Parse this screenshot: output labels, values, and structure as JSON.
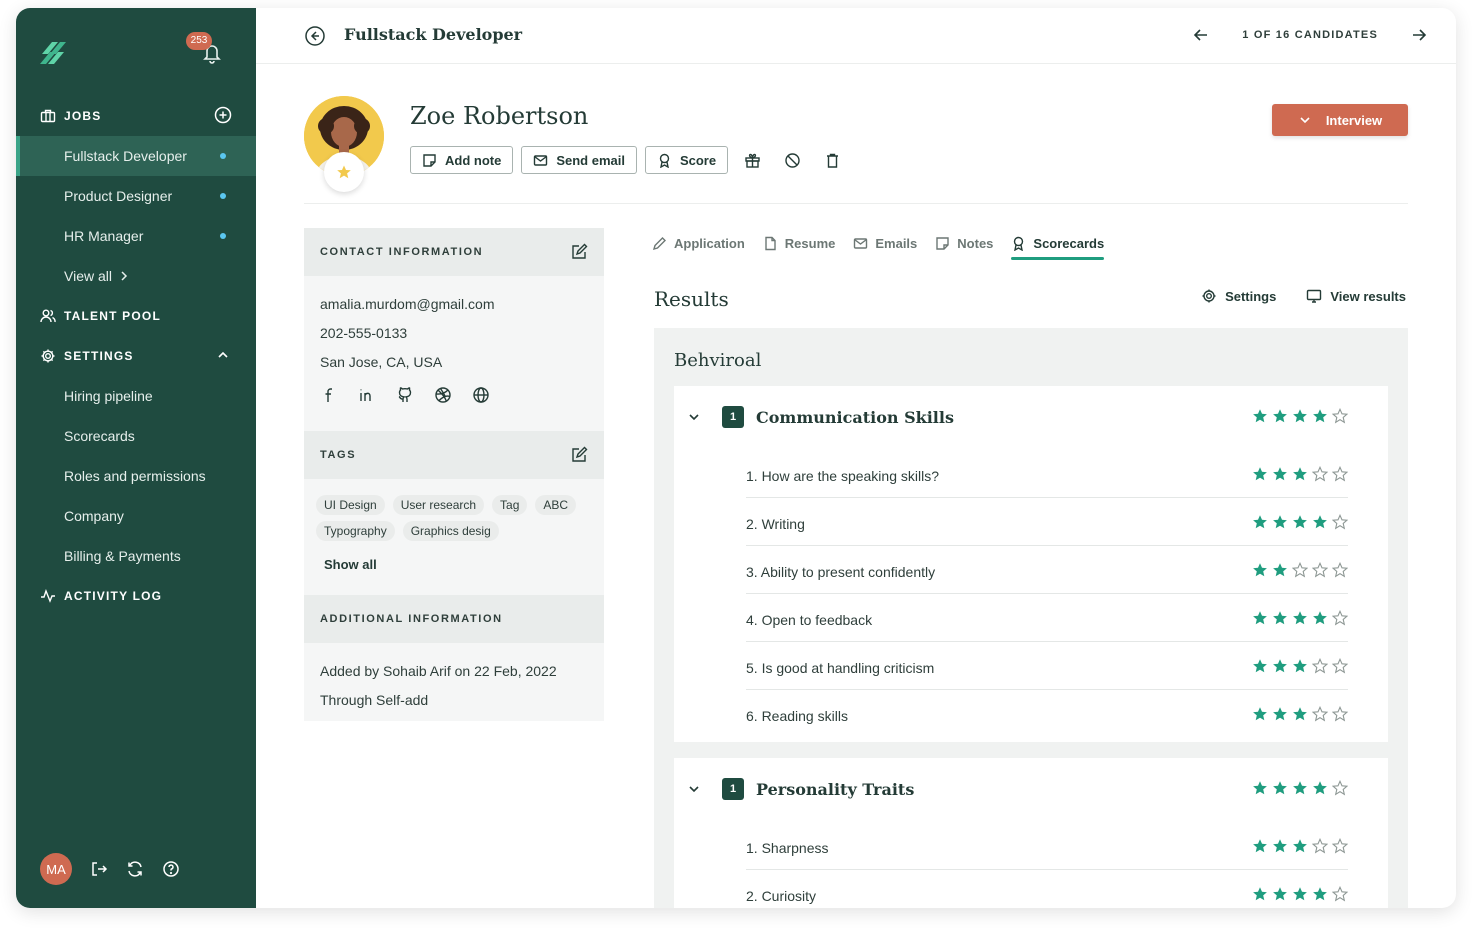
{
  "sidebar": {
    "notifications": "253",
    "jobs_label": "JOBS",
    "jobs": [
      {
        "label": "Fullstack Developer",
        "active": true
      },
      {
        "label": "Product Designer",
        "active": false
      },
      {
        "label": "HR Manager",
        "active": false
      }
    ],
    "view_all": "View all",
    "talent_pool": "TALENT POOL",
    "settings_label": "SETTINGS",
    "settings_items": [
      "Hiring pipeline",
      "Scorecards",
      "Roles and permissions",
      "Company",
      "Billing & Payments"
    ],
    "activity_log": "ACTIVITY LOG",
    "user_initials": "MA"
  },
  "topbar": {
    "job_title": "Fullstack Developer",
    "pager": "1 OF 16 CANDIDATES"
  },
  "candidate": {
    "name": "Zoe Robertson",
    "actions": {
      "add_note": "Add note",
      "send_email": "Send email",
      "score": "Score"
    },
    "stage_button": "Interview"
  },
  "contact": {
    "heading": "CONTACT INFORMATION",
    "email": "amalia.murdom@gmail.com",
    "phone": "202-555-0133",
    "location": "San Jose, CA, USA",
    "socials": [
      "facebook-icon",
      "linkedin-icon",
      "github-icon",
      "dribbble-icon",
      "globe-icon"
    ]
  },
  "tags": {
    "heading": "TAGS",
    "items": [
      "UI Design",
      "User research",
      "Tag",
      "ABC",
      "Typography",
      "Graphics desig"
    ],
    "show_all": "Show all"
  },
  "additional": {
    "heading": "ADDITIONAL INFORMATION",
    "added_by": "Added by Sohaib Arif on 22 Feb, 2022",
    "source": "Through Self-add"
  },
  "tabs": [
    "Application",
    "Resume",
    "Emails",
    "Notes",
    "Scorecards"
  ],
  "active_tab": "Scorecards",
  "results": {
    "title": "Results",
    "settings": "Settings",
    "view_results": "View results",
    "section": "Behviroal",
    "blocks": [
      {
        "number": "1",
        "name": "Communication Skills",
        "rating": 4,
        "questions": [
          {
            "text": "1. How are the speaking skills?",
            "rating": 3
          },
          {
            "text": "2. Writing",
            "rating": 4
          },
          {
            "text": "3. Ability to present confidently",
            "rating": 2
          },
          {
            "text": "4. Open to feedback",
            "rating": 4
          },
          {
            "text": "5. Is good at handling criticism",
            "rating": 3
          },
          {
            "text": "6. Reading skills",
            "rating": 3
          }
        ]
      },
      {
        "number": "1",
        "name": "Personality Traits",
        "rating": 4,
        "questions": [
          {
            "text": "1. Sharpness",
            "rating": 3
          },
          {
            "text": "2. Curiosity",
            "rating": 4
          }
        ]
      }
    ]
  },
  "colors": {
    "sidebar": "#1f4b40",
    "accent": "#cf6a51",
    "star": "#1f9d7f"
  }
}
